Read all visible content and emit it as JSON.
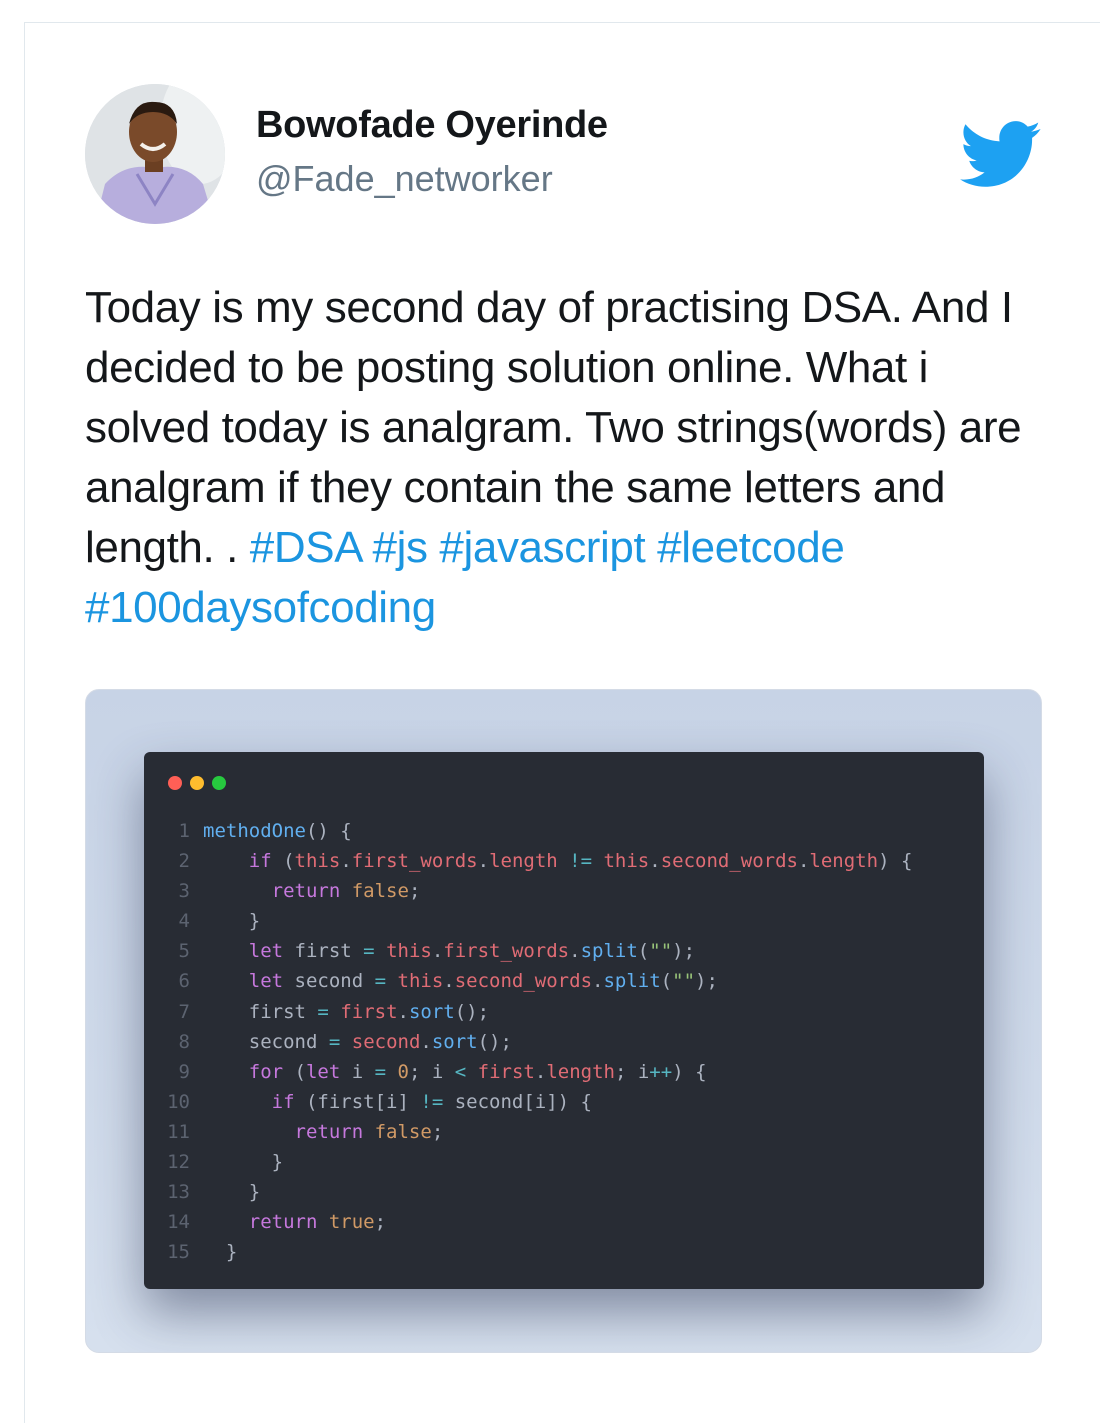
{
  "author": {
    "name": "Bowofade Oyerinde",
    "handle": "@Fade_networker"
  },
  "logo_icon": "twitter-bird-icon",
  "tweet": {
    "text": "Today is my second day of practising DSA. And I decided to be posting solution online. What i solved today is analgram. Two strings(words) are analgram if they contain the same letters and length. . ",
    "hashtags": [
      "#DSA",
      "#js",
      "#javascript",
      "#leetcode",
      "#100daysofcoding"
    ]
  },
  "colors": {
    "hashtag": "#1b95e0",
    "twitter_blue": "#1da1f2",
    "code_background": "#282c34"
  },
  "code_image": {
    "window_controls": [
      "close-dot",
      "minimize-dot",
      "maximize-dot"
    ],
    "lines": [
      {
        "n": "1",
        "tokens": [
          [
            "",
            "fn",
            "methodOne"
          ],
          [
            "",
            "def",
            "() {"
          ]
        ]
      },
      {
        "n": "2",
        "tokens": [
          [
            "    ",
            "kw",
            "if"
          ],
          [
            "",
            "def",
            " ("
          ],
          [
            "",
            "this",
            "this"
          ],
          [
            "",
            "def",
            "."
          ],
          [
            "",
            "prop",
            "first_words"
          ],
          [
            "",
            "def",
            "."
          ],
          [
            "",
            "prop",
            "length"
          ],
          [
            "",
            "op",
            " != "
          ],
          [
            "",
            "this",
            "this"
          ],
          [
            "",
            "def",
            "."
          ],
          [
            "",
            "prop",
            "second_words"
          ],
          [
            "",
            "def",
            "."
          ],
          [
            "",
            "prop",
            "length"
          ],
          [
            "",
            "def",
            ") {"
          ]
        ]
      },
      {
        "n": "3",
        "tokens": [
          [
            "      ",
            "kw",
            "return"
          ],
          [
            " ",
            "bool",
            "false"
          ],
          [
            "",
            "def",
            ";"
          ]
        ]
      },
      {
        "n": "4",
        "tokens": [
          [
            "    ",
            "def",
            "}"
          ]
        ]
      },
      {
        "n": "5",
        "tokens": [
          [
            "    ",
            "kw",
            "let"
          ],
          [
            "",
            "def",
            " first "
          ],
          [
            "",
            "op",
            "="
          ],
          [
            " ",
            "this",
            "this"
          ],
          [
            "",
            "def",
            "."
          ],
          [
            "",
            "prop",
            "first_words"
          ],
          [
            "",
            "def",
            "."
          ],
          [
            "",
            "fn",
            "split"
          ],
          [
            "",
            "def",
            "("
          ],
          [
            "",
            "str",
            "\"\""
          ],
          [
            "",
            "def",
            ");"
          ]
        ]
      },
      {
        "n": "6",
        "tokens": [
          [
            "    ",
            "kw",
            "let"
          ],
          [
            "",
            "def",
            " second "
          ],
          [
            "",
            "op",
            "="
          ],
          [
            " ",
            "this",
            "this"
          ],
          [
            "",
            "def",
            "."
          ],
          [
            "",
            "prop",
            "second_words"
          ],
          [
            "",
            "def",
            "."
          ],
          [
            "",
            "fn",
            "split"
          ],
          [
            "",
            "def",
            "("
          ],
          [
            "",
            "str",
            "\"\""
          ],
          [
            "",
            "def",
            ");"
          ]
        ]
      },
      {
        "n": "7",
        "tokens": [
          [
            "    ",
            "def",
            "first "
          ],
          [
            "",
            "op",
            "="
          ],
          [
            " ",
            "prop",
            "first"
          ],
          [
            "",
            "def",
            "."
          ],
          [
            "",
            "fn",
            "sort"
          ],
          [
            "",
            "def",
            "();"
          ]
        ]
      },
      {
        "n": "8",
        "tokens": [
          [
            "    ",
            "def",
            "second "
          ],
          [
            "",
            "op",
            "="
          ],
          [
            " ",
            "prop",
            "second"
          ],
          [
            "",
            "def",
            "."
          ],
          [
            "",
            "fn",
            "sort"
          ],
          [
            "",
            "def",
            "();"
          ]
        ]
      },
      {
        "n": "9",
        "tokens": [
          [
            "    ",
            "kw",
            "for"
          ],
          [
            "",
            "def",
            " ("
          ],
          [
            "",
            "kw",
            "let"
          ],
          [
            "",
            "def",
            " i "
          ],
          [
            "",
            "op",
            "="
          ],
          [
            " ",
            "num",
            "0"
          ],
          [
            "",
            "def",
            "; i "
          ],
          [
            "",
            "op",
            "<"
          ],
          [
            " ",
            "prop",
            "first"
          ],
          [
            "",
            "def",
            "."
          ],
          [
            "",
            "prop",
            "length"
          ],
          [
            "",
            "def",
            "; i"
          ],
          [
            "",
            "op",
            "++"
          ],
          [
            "",
            "def",
            ") {"
          ]
        ]
      },
      {
        "n": "10",
        "tokens": [
          [
            "      ",
            "kw",
            "if"
          ],
          [
            "",
            "def",
            " (first[i] "
          ],
          [
            "",
            "op",
            "!="
          ],
          [
            "",
            "def",
            " second[i]) {"
          ]
        ]
      },
      {
        "n": "11",
        "tokens": [
          [
            "        ",
            "kw",
            "return"
          ],
          [
            " ",
            "bool",
            "false"
          ],
          [
            "",
            "def",
            ";"
          ]
        ]
      },
      {
        "n": "12",
        "tokens": [
          [
            "      ",
            "def",
            "}"
          ]
        ]
      },
      {
        "n": "13",
        "tokens": [
          [
            "    ",
            "def",
            "}"
          ]
        ]
      },
      {
        "n": "14",
        "tokens": [
          [
            "    ",
            "kw",
            "return"
          ],
          [
            " ",
            "bool",
            "true"
          ],
          [
            "",
            "def",
            ";"
          ]
        ]
      },
      {
        "n": "15",
        "tokens": [
          [
            "  ",
            "def",
            "}"
          ]
        ]
      }
    ]
  }
}
